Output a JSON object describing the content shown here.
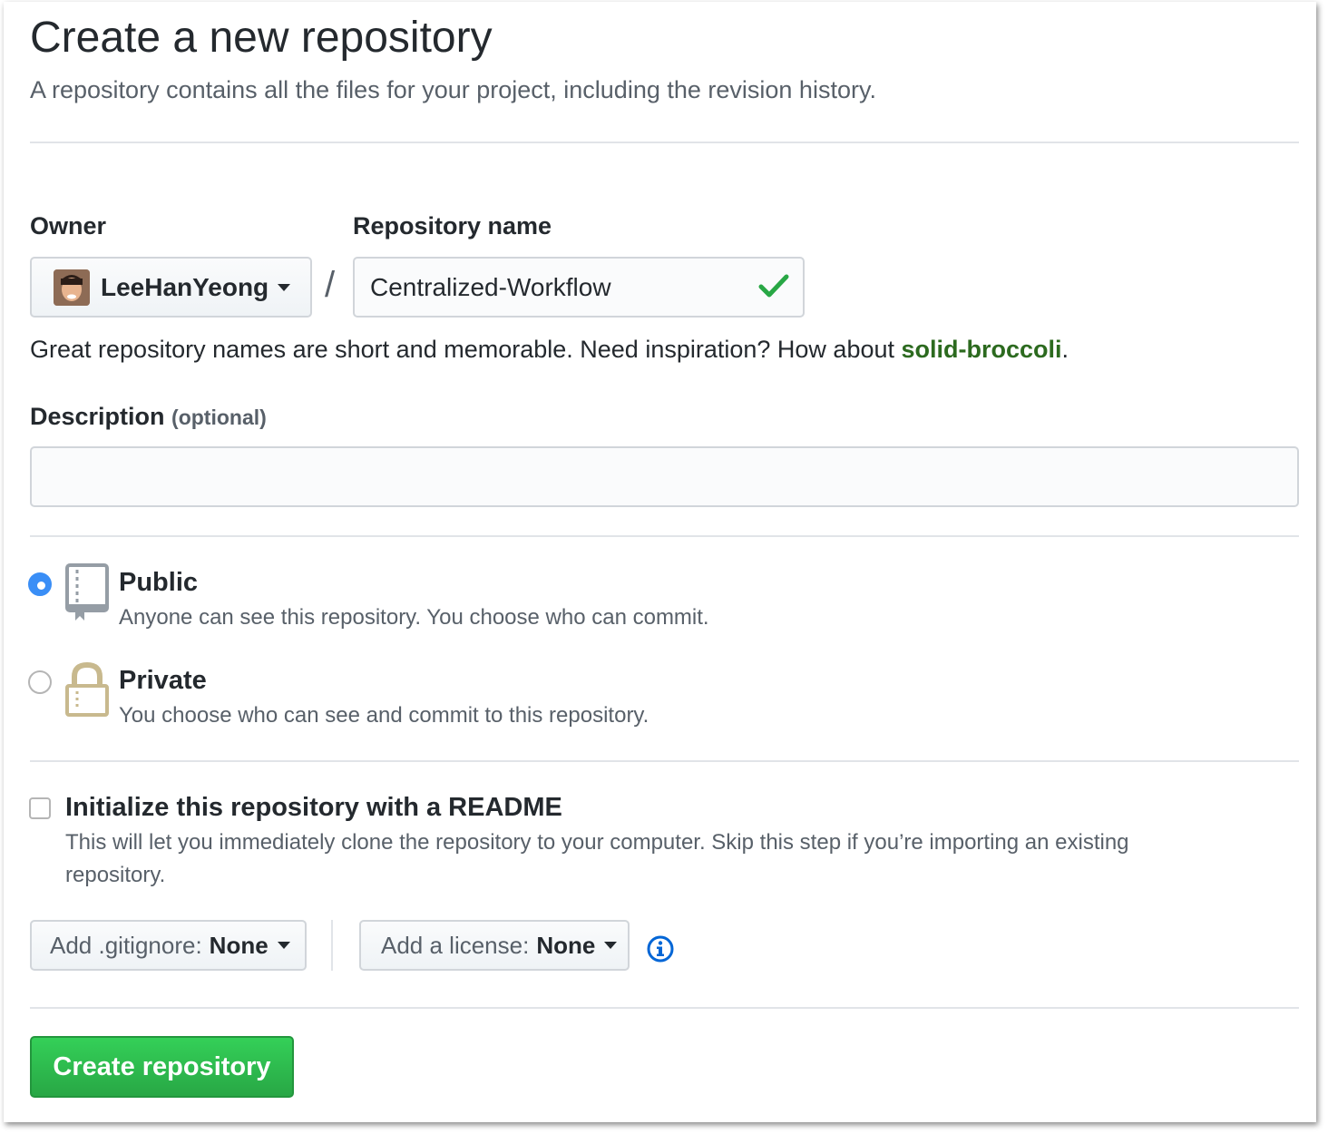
{
  "header": {
    "title": "Create a new repository",
    "subtitle": "A repository contains all the files for your project, including the revision history."
  },
  "owner": {
    "label": "Owner",
    "value": "LeeHanYeong"
  },
  "separator": "/",
  "repo_name": {
    "label": "Repository name",
    "value": "Centralized-Workflow",
    "valid": true
  },
  "hint": {
    "prefix": "Great repository names are short and memorable. Need inspiration? How about ",
    "suggestion": "solid-broccoli",
    "suffix": "."
  },
  "description": {
    "label": "Description",
    "optional": "(optional)",
    "value": ""
  },
  "visibility": {
    "selected": "public",
    "public": {
      "title": "Public",
      "desc": "Anyone can see this repository. You choose who can commit."
    },
    "private": {
      "title": "Private",
      "desc": "You choose who can see and commit to this repository."
    }
  },
  "readme": {
    "checked": false,
    "title": "Initialize this repository with a README",
    "desc_line1": "This will let you immediately clone the repository to your computer. Skip this step if you’re importing an existing",
    "desc_line2": "repository."
  },
  "gitignore": {
    "label": "Add .gitignore:",
    "value": "None"
  },
  "license": {
    "label": "Add a license:",
    "value": "None"
  },
  "submit": {
    "label": "Create repository"
  },
  "colors": {
    "accent_blue": "#3a8ef6",
    "success_green": "#28a745",
    "suggestion_green": "#2c6a1f",
    "info_blue": "#0366d6"
  }
}
